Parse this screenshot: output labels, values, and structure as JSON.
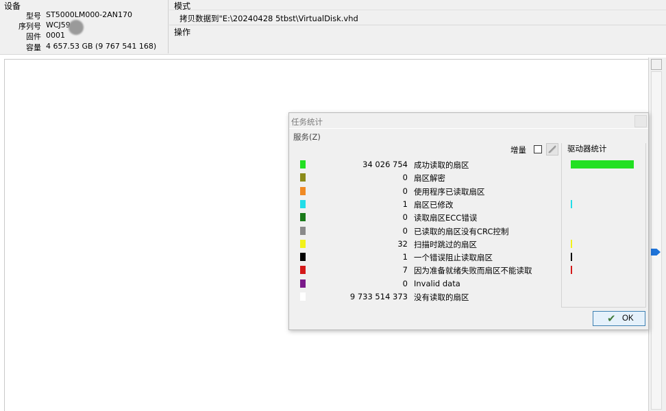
{
  "device": {
    "title": "设备",
    "rows": [
      {
        "label": "型号",
        "value": "ST5000LM000-2AN170"
      },
      {
        "label": "序列号",
        "value": "WCJ59"
      },
      {
        "label": "固件",
        "value": "0001"
      },
      {
        "label": "容量",
        "value": "4 657.53 GB (9 767 541 168)"
      }
    ]
  },
  "mode": {
    "title": "模式",
    "value": "拷贝数据到\"E:\\20240428 5tbst\\VirtualDisk.vhd"
  },
  "operation": {
    "title": "操作"
  },
  "dialog": {
    "title": "任务统计",
    "menu": "服务(Z)",
    "increment_label": "增量",
    "drive_stats_title": "驱动器统计",
    "ok_label": "OK",
    "stats": [
      {
        "color": "#22e022",
        "count": "34 026 754",
        "label": "成功读取的扇区",
        "bar": 1.0
      },
      {
        "color": "#8b8b1a",
        "count": "0",
        "label": "扇区解密",
        "bar": 0
      },
      {
        "color": "#f08a24",
        "count": "0",
        "label": "使用程序已读取扇区",
        "bar": 0
      },
      {
        "color": "#22dde8",
        "count": "1",
        "label": "扇区已修改",
        "bar": 0.02
      },
      {
        "color": "#1a7a1a",
        "count": "0",
        "label": "读取扇区ECC错误",
        "bar": 0
      },
      {
        "color": "#8a8a8a",
        "count": "0",
        "label": "已读取的扇区没有CRC控制",
        "bar": 0
      },
      {
        "color": "#f2f21a",
        "count": "32",
        "label": "扫描时跳过的扇区",
        "bar": 0.02
      },
      {
        "color": "#000000",
        "count": "1",
        "label": "一个错误阻止读取扇区",
        "bar": 0.02
      },
      {
        "color": "#d41a1a",
        "count": "7",
        "label": "因为准备就绪失败而扇区不能读取",
        "bar": 0.02
      },
      {
        "color": "#7a1a8a",
        "count": "0",
        "label": "Invalid data",
        "bar": 0
      },
      {
        "color": "#ffffff",
        "count": "9 733 514 373",
        "label": "没有读取的扇区",
        "bar": 0
      }
    ]
  }
}
